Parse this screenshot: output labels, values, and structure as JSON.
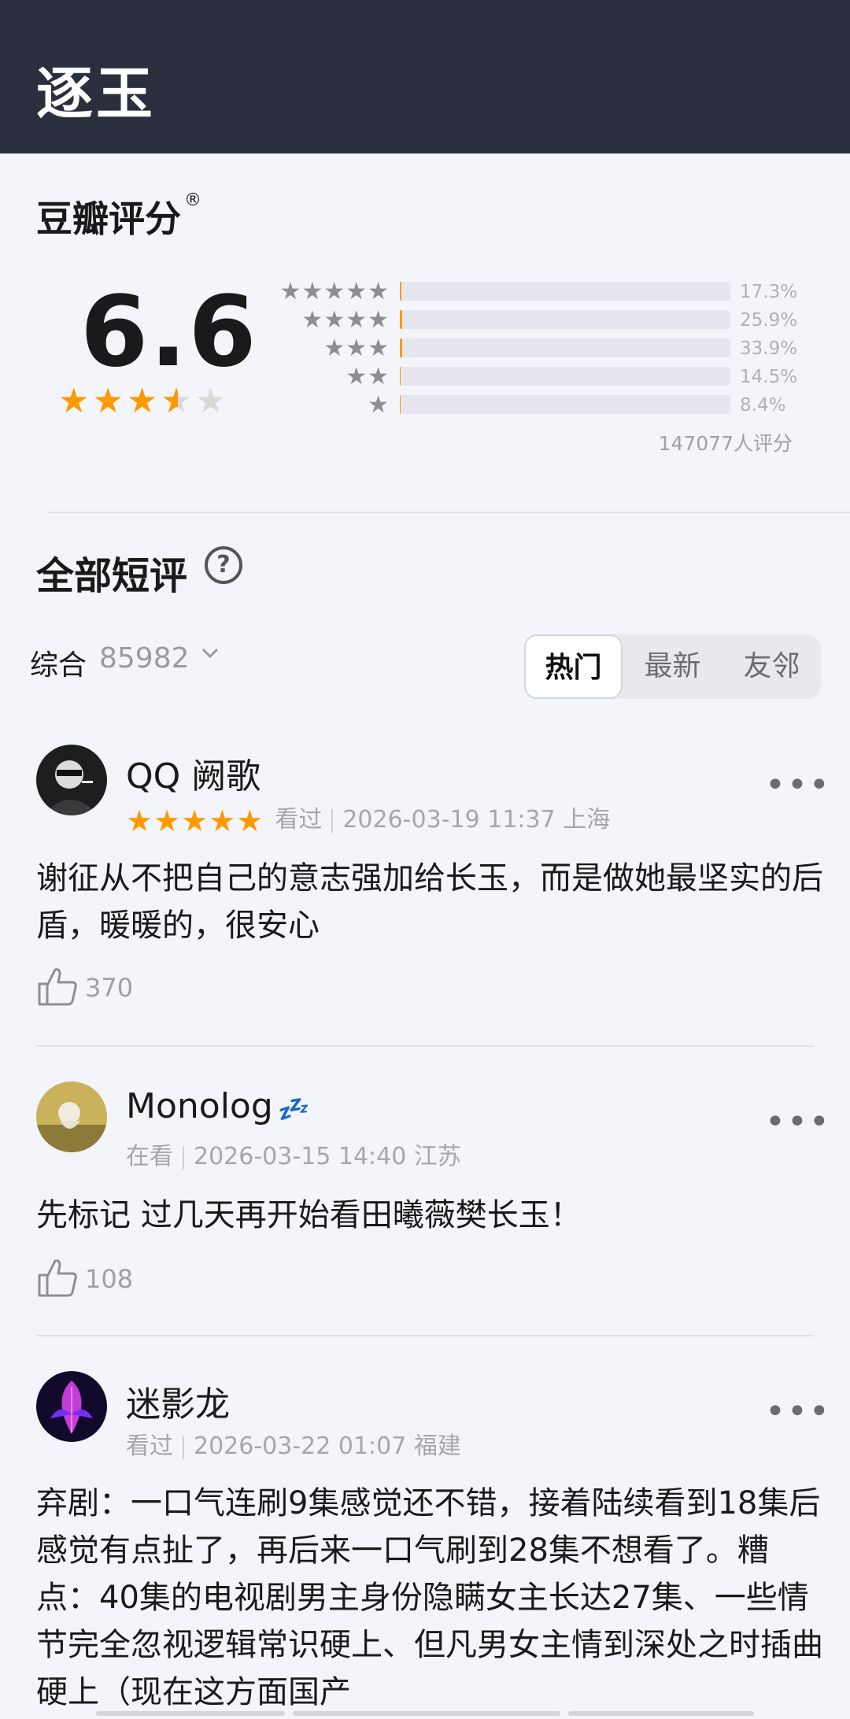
{
  "header": {
    "title": "逐玉"
  },
  "rating": {
    "label": "豆瓣评分",
    "reg_mark": "®",
    "score": "6.6",
    "stars_value": 3.5,
    "distribution": [
      {
        "stars": "★★★★★",
        "percent_value": 17.3,
        "percent": "17.3%"
      },
      {
        "stars": "★★★★",
        "percent_value": 25.9,
        "percent": "25.9%"
      },
      {
        "stars": "★★★",
        "percent_value": 33.9,
        "percent": "33.9%"
      },
      {
        "stars": "★★",
        "percent_value": 14.5,
        "percent": "14.5%"
      },
      {
        "stars": "★",
        "percent_value": 8.4,
        "percent": "8.4%"
      }
    ],
    "total": "147077人评分"
  },
  "reviews_section": {
    "title": "全部短评",
    "help_icon": "question-circle-icon",
    "sort_label": "综合",
    "count": "85982",
    "chevron": "⌄",
    "tabs": [
      "热门",
      "最新",
      "友邻"
    ],
    "active_tab": "热门"
  },
  "reviews": [
    {
      "user": "QQ 阙歌",
      "stars": "★★★★★",
      "status": "看过",
      "time": "2026-03-19 11:37 上海",
      "text": "谢征从不把自己的意志强加给长玉，而是做她最坚实的后盾，暖暖的，很安心",
      "likes": "370"
    },
    {
      "user": "Monolog",
      "user_suffix": "💤",
      "status": "在看",
      "time": "2026-03-15 14:40 江苏",
      "text": "先标记 过几天再开始看田曦薇樊长玉！",
      "likes": "108"
    },
    {
      "user": "迷影龙",
      "status": "看过",
      "time": "2026-03-22 01:07 福建",
      "text": "弃剧：一口气连刷9集感觉还不错，接着陆续看到18集后感觉有点扯了，再后来一口气刷到28集不想看了。糟点：40集的电视剧男主身份隐瞒女主长达27集、一些情节完全忽视逻辑常识硬上、但凡男女主情到深处之时插曲硬上（现在这方面国产"
    }
  ],
  "more_icon": "•••",
  "colors": {
    "header_bg": "#2b2f3d",
    "accent": "#ff9900",
    "page_bg": "#f4f5fa"
  }
}
